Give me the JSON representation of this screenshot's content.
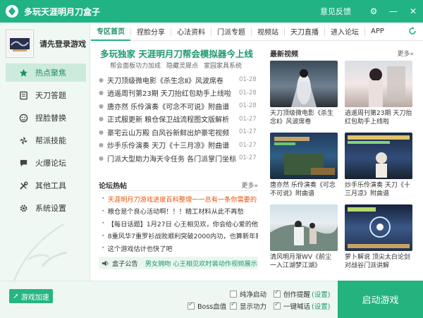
{
  "app": {
    "title": "多玩天涯明月刀盒子",
    "feedback": "意见反馈"
  },
  "profile": {
    "login_text": "请先登录游戏"
  },
  "sidebar": {
    "items": [
      {
        "label": "热点聚焦",
        "icon": "star-icon"
      },
      {
        "label": "天刀答题",
        "icon": "book-icon"
      },
      {
        "label": "捏脸替换",
        "icon": "face-icon"
      },
      {
        "label": "帮派技能",
        "icon": "pinwheel-icon"
      },
      {
        "label": "火爆论坛",
        "icon": "chat-bubble-icon"
      },
      {
        "label": "其他工具",
        "icon": "tools-icon"
      },
      {
        "label": "系统设置",
        "icon": "gear-icon"
      }
    ]
  },
  "tabs": [
    "专区首页",
    "捏脸分享",
    "心法资料",
    "门派专题",
    "视频站",
    "天刀直播",
    "进入论坛",
    "APP"
  ],
  "headline": "多玩独家 天涯明月刀帮会模拟器今上线",
  "subhead": [
    "帮会面板功力加成",
    "隐藏灵犀点",
    "家园家具系统"
  ],
  "news": [
    {
      "title": "天刀顶级微电影《杀生念Ⅱ》风波席卷",
      "date": "01-28"
    },
    {
      "title": "逍遥周刊第23期 天刀抬红包助手上线啦",
      "date": "01-28"
    },
    {
      "title": "唐亦然 乐伶演奏《可念不可说》附曲谱",
      "date": "01-28"
    },
    {
      "title": "正式服更新 粮仓保卫战流程图文版解析",
      "date": "01-27"
    },
    {
      "title": "豪宅云山万殿 白风谷新鲜出炉豪宅视频",
      "date": "01-27"
    },
    {
      "title": "炒手乐伶演奏 天刀《十三月凉》附曲谱",
      "date": "01-27"
    },
    {
      "title": "门派大型助力海天令任务 各门派掌门坐标",
      "date": "01-27"
    }
  ],
  "forum": {
    "title": "论坛热帖",
    "more": "更多»",
    "items": [
      {
        "text": "天涯明月刀游戏进度百科整理一一总有一条你需要的",
        "hot": true
      },
      {
        "text": "粮仓是个良心活动啊！！！精工材料从此不再愁",
        "hot": false
      },
      {
        "text": "【每日话题】1月27日 心王相见欢，你会给心爱的他/她",
        "hot": false
      },
      {
        "text": "8重风华7重罗衫战败顺利突破2000内功，也算新年新气象",
        "hot": false
      },
      {
        "text": "这个游戏估计也快了吧",
        "hot": false
      }
    ]
  },
  "notice": {
    "label": "盒子公告",
    "text": "男女拥吻 心王相见欢时装动作视频展示"
  },
  "videos": {
    "title": "最新视频",
    "more": "更多»",
    "items": [
      {
        "caption": "天刀顶级微电影《杀生念Ⅱ》风波席卷"
      },
      {
        "caption": "逍遥周刊第23期 天刀抬红包助手上线啦"
      },
      {
        "caption": "唐亦然 乐伶演奏《可念不可说》附曲谱"
      },
      {
        "caption": "炒手乐伶演奏 天刀《十三月凉》附曲谱"
      },
      {
        "caption": "清风明月渐WV《前尘一入江湖梦江湖》"
      },
      {
        "caption": "萝卜解说 顶尖太白论剑对战谷门派讲解"
      }
    ]
  },
  "bottom": {
    "speed_label": "游戏加速",
    "options": {
      "pure_start": "纯净启动",
      "boss_hp": "Boss血值",
      "show_power": "显示功力",
      "create_remind": "创作提醒",
      "one_key_shout": "一键喊话",
      "settings_link": "(设置)"
    },
    "start_label": "启动游戏"
  }
}
